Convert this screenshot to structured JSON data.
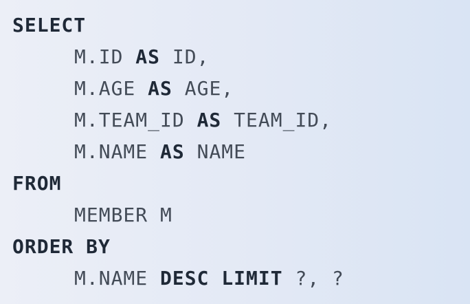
{
  "code": {
    "select_kw": "SELECT",
    "lines": [
      {
        "pre": "M.ID",
        "as": "AS",
        "alias": "ID,"
      },
      {
        "pre": "M.AGE",
        "as": "AS",
        "alias": "AGE,"
      },
      {
        "pre": "M.TEAM_ID",
        "as": "AS",
        "alias": "TEAM_ID,"
      },
      {
        "pre": "M.NAME",
        "as": "AS",
        "alias": "NAME"
      }
    ],
    "from_kw": "FROM",
    "from_table": "MEMBER M",
    "order_kw": "ORDER BY",
    "order_col": "M.NAME",
    "desc_kw": "DESC",
    "limit_kw": "LIMIT",
    "limit_params": "?, ?"
  },
  "colors": {
    "keyword": "#1f2937",
    "identifier": "#434b57",
    "background": "#e8edf6"
  }
}
